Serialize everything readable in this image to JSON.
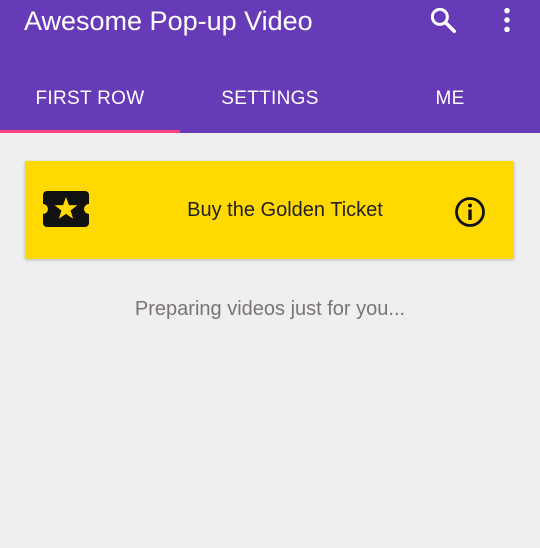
{
  "app_bar": {
    "title": "Awesome Pop-up Video",
    "background_color": "#673AB7",
    "actions": [
      {
        "name": "search",
        "icon": "search-icon"
      },
      {
        "name": "more-options",
        "icon": "more-vert-icon"
      }
    ]
  },
  "tabs": [
    {
      "label": "FIRST ROW",
      "active": true
    },
    {
      "label": "SETTINGS",
      "active": false
    },
    {
      "label": "ME",
      "active": false
    }
  ],
  "tab_indicator_color": "#FF4081",
  "golden_card": {
    "label": "Buy the Golden Ticket",
    "background_color": "#FFD900",
    "leading_icon": "ticket-star-icon",
    "trailing_icon": "info-icon"
  },
  "status": {
    "message": "Preparing videos just for you..."
  }
}
